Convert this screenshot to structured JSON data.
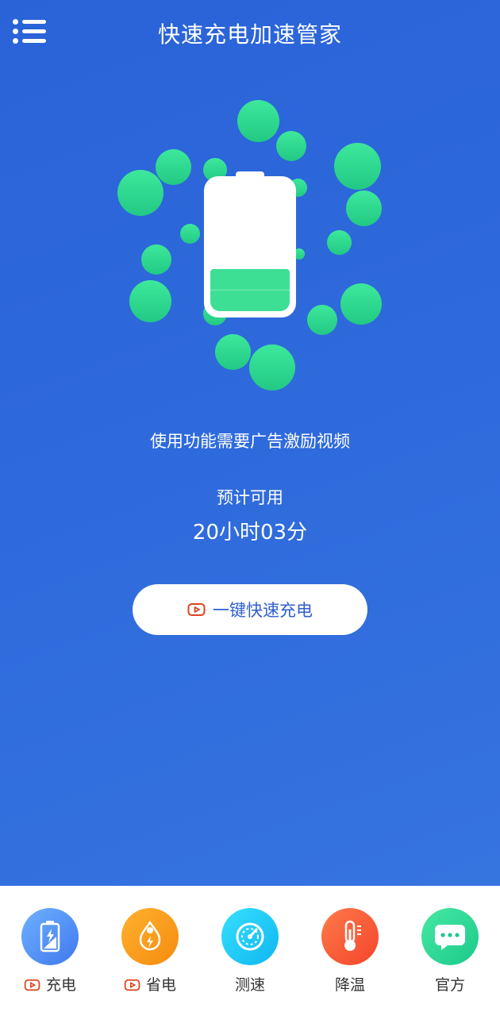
{
  "app": {
    "title": "快速充电加速管家"
  },
  "main": {
    "notice": "使用功能需要广告激励视频",
    "estimate_label": "预计可用",
    "estimate_value": "20小时03分",
    "battery_level": 0.33,
    "charge_button": {
      "label": "一键快速充电",
      "icon": "video-play-icon"
    }
  },
  "colors": {
    "background": "#2f6bdc",
    "bubble": "#2ed48e",
    "battery_fill": "#3ddf95",
    "accent_text": "#2f5ed0",
    "ad_icon": "#d9461f"
  },
  "bottom_nav": {
    "items": [
      {
        "label": "充电",
        "icon": "battery-charge-icon",
        "ad": true
      },
      {
        "label": "省电",
        "icon": "power-save-icon",
        "ad": true
      },
      {
        "label": "测速",
        "icon": "speedometer-icon",
        "ad": false
      },
      {
        "label": "降温",
        "icon": "thermometer-icon",
        "ad": false
      },
      {
        "label": "官方",
        "icon": "chat-icon",
        "ad": false
      }
    ]
  }
}
